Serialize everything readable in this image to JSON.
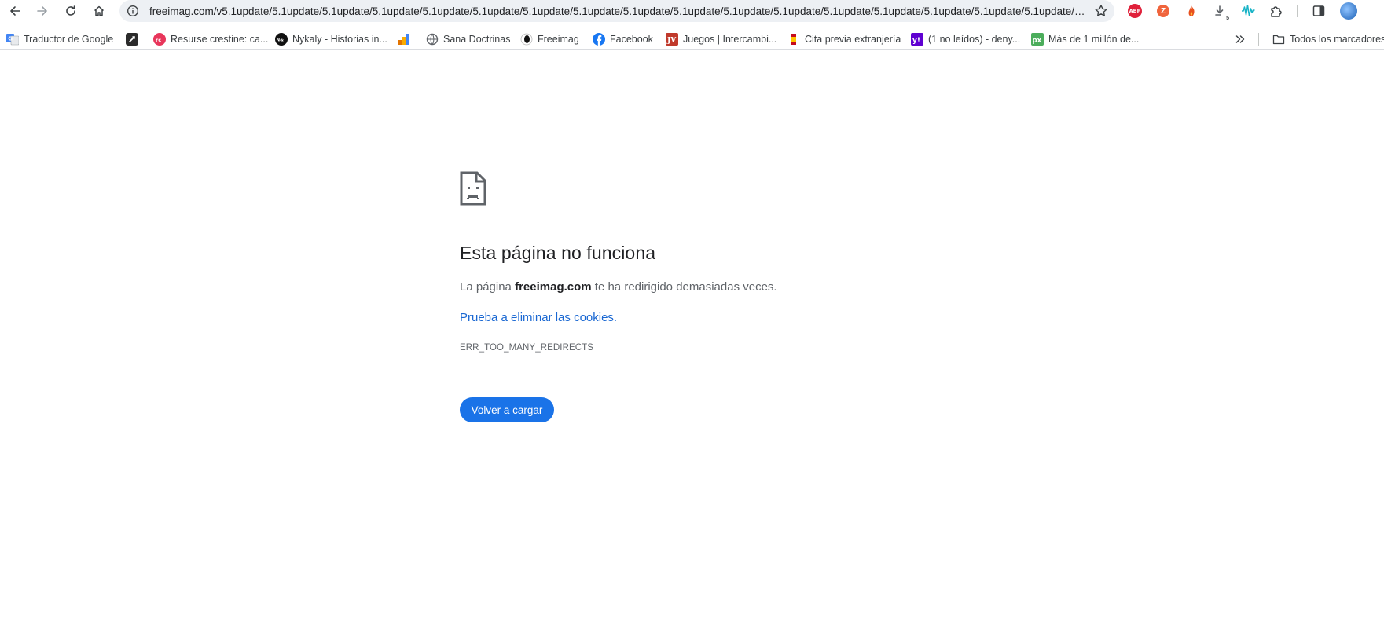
{
  "browser": {
    "url": "freeimag.com/v5.1update/5.1update/5.1update/5.1update/5.1update/5.1update/5.1update/5.1update/5.1update/5.1update/5.1update/5.1update/5.1update/5.1update/5.1update/5.1update/5.1update/5.1update",
    "nav_icons": [
      "back-icon",
      "forward-icon",
      "reload-icon",
      "home-icon"
    ],
    "extensions": [
      {
        "name": "adblock-plus-icon",
        "text": "ABP",
        "color": "#e0203a"
      },
      {
        "name": "z-extension-icon",
        "text": "Z",
        "color": "#f0643c"
      },
      {
        "name": "flame-extension-icon",
        "color": "#e8501e"
      },
      {
        "name": "download-extension-icon",
        "badge": "5"
      },
      {
        "name": "waves-extension-icon",
        "color": "#17b3c6"
      },
      {
        "name": "puzzle-extensions-icon"
      },
      {
        "name": "side-panel-icon"
      },
      {
        "name": "profile-avatar"
      }
    ]
  },
  "bookmarks": {
    "items": [
      {
        "label": "Traductor de Google",
        "icon": "google-translate-icon"
      },
      {
        "label": "",
        "icon": "dark-square-icon"
      },
      {
        "label": "Resurse crestine: ca...",
        "icon": "resurse-icon"
      },
      {
        "label": "Nykaly - Historias in...",
        "icon": "nykaly-icon"
      },
      {
        "label": "",
        "icon": "analytics-bars-icon"
      },
      {
        "label": "Sana Doctrinas",
        "icon": "globe-icon"
      },
      {
        "label": "Freeimag",
        "icon": "freeimag-icon"
      },
      {
        "label": "Facebook",
        "icon": "facebook-icon"
      },
      {
        "label": "Juegos | Intercambi...",
        "icon": "juegos-icon"
      },
      {
        "label": "Cita previa extranjería",
        "icon": "spain-flag-icon"
      },
      {
        "label": "(1 no leídos) - deny...",
        "icon": "yahoo-icon"
      },
      {
        "label": "Más de 1 millón de...",
        "icon": "pixabay-icon"
      }
    ],
    "overflow_icon": "chevron-double-right-icon",
    "all_bookmarks_label": "Todos los marcadores"
  },
  "error": {
    "icon": "sad-document-icon",
    "title": "Esta página no funciona",
    "desc_prefix": "La página ",
    "desc_domain": "freeimag.com",
    "desc_suffix": " te ha redirigido demasiadas veces.",
    "link": "Prueba a eliminar las cookies.",
    "code": "ERR_TOO_MANY_REDIRECTS",
    "button": "Volver a cargar",
    "button_color": "#1a73e8",
    "link_color": "#1967d2"
  }
}
